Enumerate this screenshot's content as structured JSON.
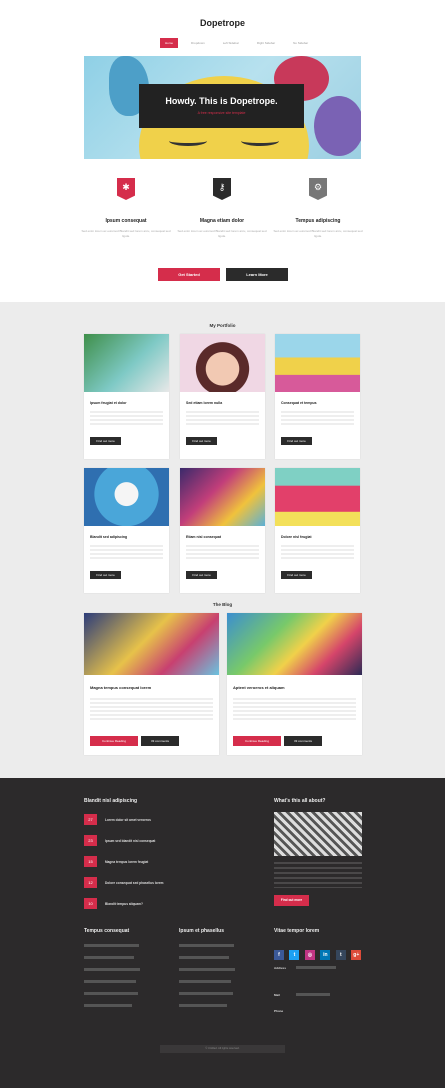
{
  "site": {
    "logo": "Dopetrope"
  },
  "nav": [
    {
      "label": "Home",
      "active": true
    },
    {
      "label": "Dropdown",
      "active": false
    },
    {
      "label": "Left Sidebar",
      "active": false
    },
    {
      "label": "Right Sidebar",
      "active": false
    },
    {
      "label": "No Sidebar",
      "active": false
    }
  ],
  "hero": {
    "title": "Howdy. This is Dopetrope.",
    "subtitle": "A free responsive site template"
  },
  "features": [
    {
      "title": "Ipsum consequat",
      "text": "Sed enim lorem ac euismod Blandit sed lorem arcu, consequat sed ligula.",
      "icon": "gear-icon",
      "color": "#d52d4b"
    },
    {
      "title": "Magna etiam dolor",
      "text": "Sed enim lorem ac euismod Blandit sed lorem arcu, consequat sed ligula.",
      "icon": "key-icon",
      "color": "#2b2b2b"
    },
    {
      "title": "Tempus adipiscing",
      "text": "Sed enim lorem ac euismod Blandit sed lorem arcu, consequat sed ligula.",
      "icon": "cog-icon",
      "color": "#777777"
    }
  ],
  "cta": {
    "primary": "Get Started",
    "secondary": "Learn More"
  },
  "portfolio": {
    "title": "My Portfolio",
    "items": [
      {
        "title": "Ipsum feugiat et dolor",
        "button": "Find out more"
      },
      {
        "title": "Sed etiam lorem nulla",
        "button": "Find out more"
      },
      {
        "title": "Consequat et tempus",
        "button": "Find out more"
      },
      {
        "title": "Blandit sed adipiscing",
        "button": "Find out more"
      },
      {
        "title": "Etiam nisl consequat",
        "button": "Find out more"
      },
      {
        "title": "Dolore nisl feugiat",
        "button": "Find out more"
      }
    ]
  },
  "blog": {
    "title": "The Blog",
    "posts": [
      {
        "title": "Magna tempus consequat lorem",
        "meta": "",
        "read": "Continue Reading",
        "comments": "33 comments"
      },
      {
        "title": "Aptent veroeros et aliquam",
        "meta": "",
        "read": "Continue Reading",
        "comments": "33 comments"
      }
    ]
  },
  "footer": {
    "recent_title": "Blandit nisl adipiscing",
    "recent": [
      {
        "day": "27",
        "title": "Lorem dolor sit amet veroeros"
      },
      {
        "day": "23",
        "title": "Ipsum sed blandit nisl consequat"
      },
      {
        "day": "15",
        "title": "Magna tempus lorem feugiat"
      },
      {
        "day": "12",
        "title": "Dolore consequat sed phasellus lorem"
      },
      {
        "day": "10",
        "title": "Blandit tempus aliquam?"
      }
    ],
    "about_title": "What's this all about?",
    "about_button": "Find out more",
    "col1_title": "Tempus consequat",
    "col2_title": "Ipsum et phasellus",
    "contact_title": "Vitae tempor lorem",
    "contact_labels": {
      "address": "Address",
      "mail": "Mail",
      "phone": "Phone"
    },
    "social": [
      {
        "glyph": "f",
        "color": "#3b5998",
        "icon": "facebook-icon"
      },
      {
        "glyph": "t",
        "color": "#1da1f2",
        "icon": "twitter-icon"
      },
      {
        "glyph": "◎",
        "color": "#c13584",
        "icon": "dribbble-icon"
      },
      {
        "glyph": "in",
        "color": "#0077b5",
        "icon": "linkedin-icon"
      },
      {
        "glyph": "t",
        "color": "#35465c",
        "icon": "tumblr-icon"
      },
      {
        "glyph": "g+",
        "color": "#dd4b39",
        "icon": "googleplus-icon"
      }
    ],
    "copyright": "© Untitled. All rights reserved."
  }
}
